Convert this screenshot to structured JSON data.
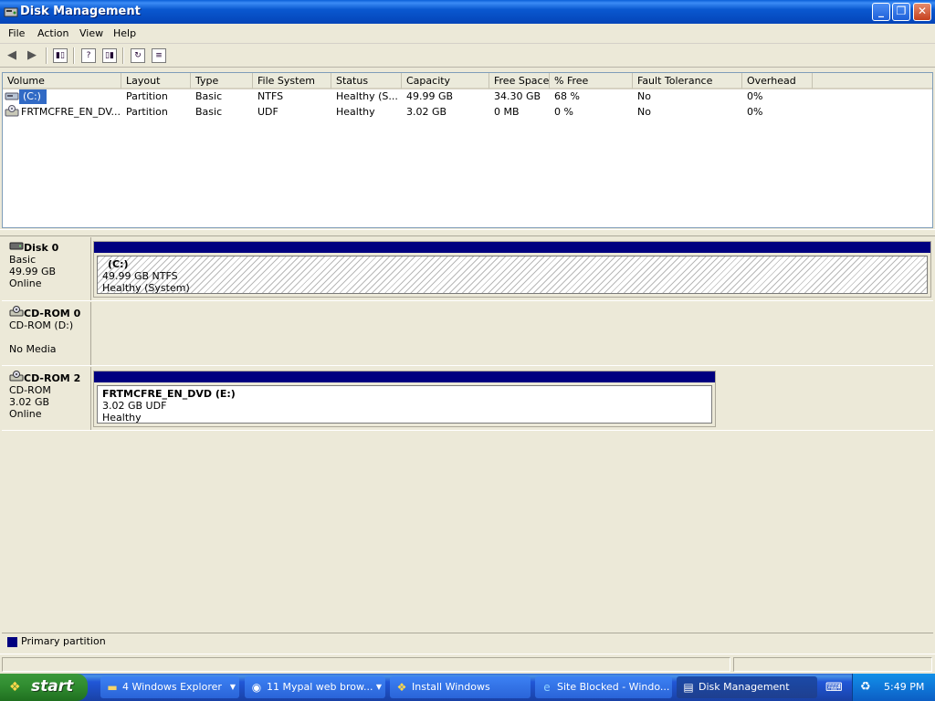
{
  "window": {
    "title": "Disk Management"
  },
  "menu": [
    "File",
    "Action",
    "View",
    "Help"
  ],
  "list": {
    "columns": [
      "Volume",
      "Layout",
      "Type",
      "File System",
      "Status",
      "Capacity",
      "Free Space",
      "% Free",
      "Fault Tolerance",
      "Overhead"
    ],
    "rows": [
      [
        "(C:)",
        "Partition",
        "Basic",
        "NTFS",
        "Healthy (S...",
        "49.99 GB",
        "34.30 GB",
        "68 %",
        "No",
        "0%"
      ],
      [
        "FRTMCFRE_EN_DV...",
        "Partition",
        "Basic",
        "UDF",
        "Healthy",
        "3.02 GB",
        "0 MB",
        "0 %",
        "No",
        "0%"
      ]
    ]
  },
  "disks": [
    {
      "name": "Disk 0",
      "line1": "Basic",
      "line2": "49.99 GB",
      "line3": "Online",
      "volume": {
        "name": "(C:)",
        "detail": "49.99 GB NTFS",
        "status": "Healthy (System)"
      }
    },
    {
      "name": "CD-ROM 0",
      "line1": "CD-ROM (D:)",
      "line2": "",
      "line3": "No Media"
    },
    {
      "name": "CD-ROM 2",
      "line1": "CD-ROM",
      "line2": "3.02 GB",
      "line3": "Online",
      "volume": {
        "name": "FRTMCFRE_EN_DVD  (E:)",
        "detail": "3.02 GB UDF",
        "status": "Healthy"
      }
    }
  ],
  "legend": {
    "label": "Primary partition",
    "color": "#000080"
  },
  "taskbar": {
    "start": "start",
    "tasks": [
      {
        "label": "4 Windows Explorer",
        "icon": "folder-icon"
      },
      {
        "label": "11 Mypal web brow...",
        "icon": "browser-icon"
      },
      {
        "label": "Install Windows",
        "icon": "windows-icon"
      },
      {
        "label": "Site Blocked - Windo...",
        "icon": "ie-icon"
      },
      {
        "label": "Disk Management",
        "icon": "disk-management-icon"
      }
    ],
    "clock": "5:49 PM"
  }
}
